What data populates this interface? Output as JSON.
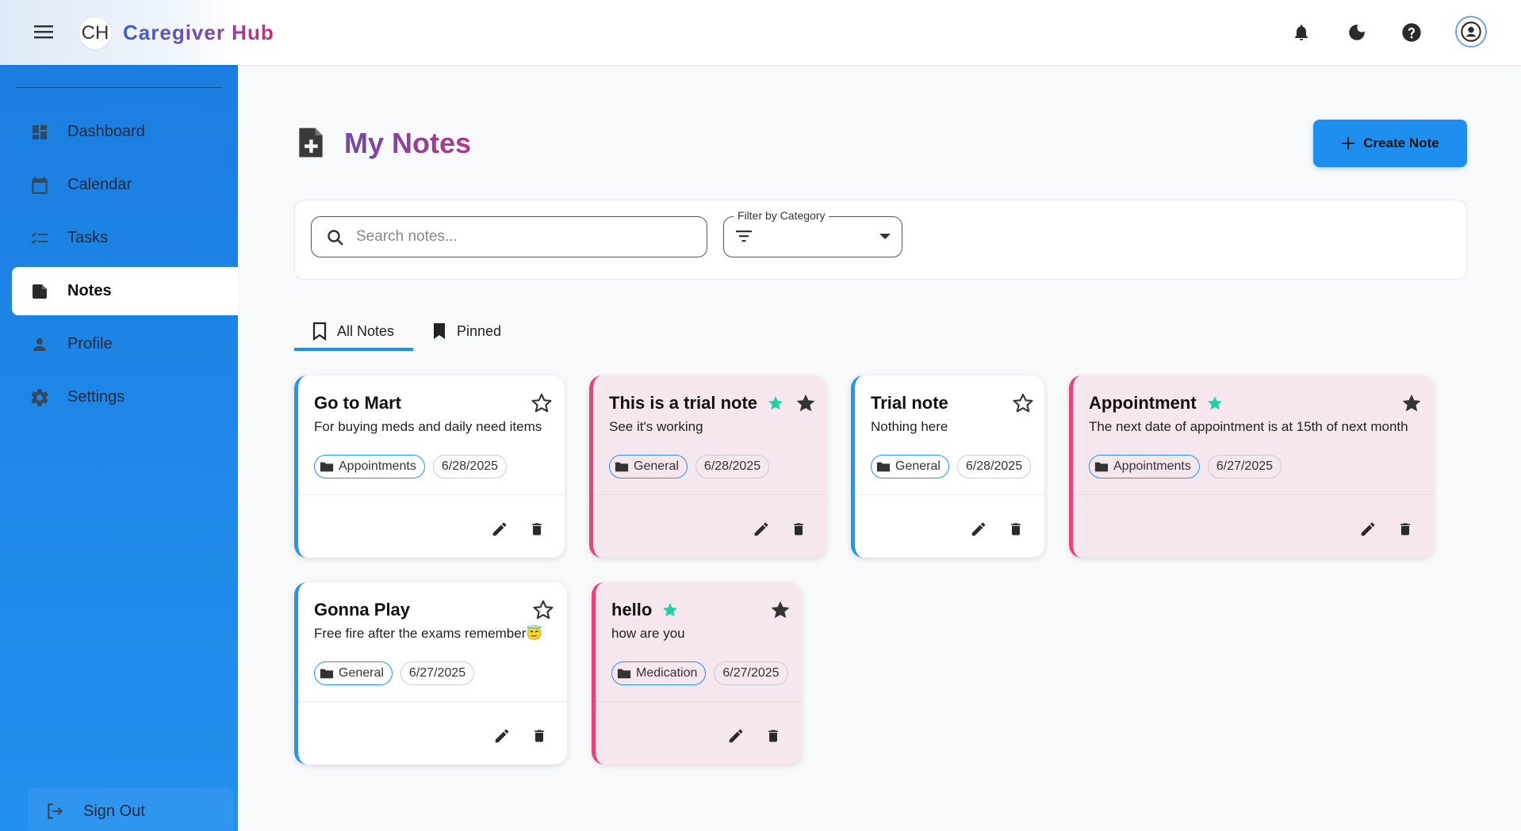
{
  "header": {
    "logo_text": "CH",
    "app_title": "Caregiver Hub",
    "icons": [
      "menu-icon",
      "bell-icon",
      "moon-icon",
      "help-icon",
      "account-icon"
    ]
  },
  "sidebar": {
    "items": [
      {
        "label": "Dashboard",
        "icon": "dashboard-icon"
      },
      {
        "label": "Calendar",
        "icon": "calendar-icon"
      },
      {
        "label": "Tasks",
        "icon": "checklist-icon"
      },
      {
        "label": "Notes",
        "icon": "note-icon",
        "active": true
      },
      {
        "label": "Profile",
        "icon": "person-icon"
      },
      {
        "label": "Settings",
        "icon": "gear-icon"
      }
    ],
    "sign_out": "Sign Out"
  },
  "main": {
    "title": "My Notes",
    "create_label": "Create Note",
    "search": {
      "placeholder": "Search notes..."
    },
    "category_filter": {
      "label": "Filter by Category",
      "value": ""
    },
    "tabs": [
      {
        "label": "All Notes",
        "active": true
      },
      {
        "label": "Pinned"
      }
    ],
    "notes": [
      {
        "title": "Go to Mart",
        "body": "For buying meds and daily need items",
        "category": "Appointments",
        "date": "6/28/2025",
        "pinned": false
      },
      {
        "title": "This is a trial note",
        "body": "See it's working",
        "category": "General",
        "date": "6/28/2025",
        "pinned": true
      },
      {
        "title": "Trial note",
        "body": "Nothing here",
        "category": "General",
        "date": "6/28/2025",
        "pinned": false
      },
      {
        "title": "Appointment",
        "body": "The next date of appointment is at 15th of next month",
        "category": "Appointments",
        "date": "6/27/2025",
        "pinned": true
      },
      {
        "title": "Gonna Play",
        "body": "Free fire after the exams remember😇",
        "category": "General",
        "date": "6/27/2025",
        "pinned": false
      },
      {
        "title": "hello",
        "body": "how are you",
        "category": "Medication",
        "date": "6/27/2025",
        "pinned": true
      }
    ]
  },
  "colors": {
    "primary": "#1f8fef",
    "pinned_accent": "#ec407a",
    "pinned_bg": "#f6e6ee",
    "pin_star": "#1dd1a1",
    "sidebar": "#1b7ee0"
  }
}
